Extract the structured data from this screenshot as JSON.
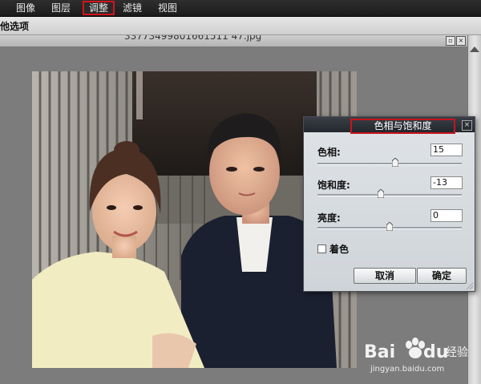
{
  "menubar": {
    "items": [
      "图像",
      "图层",
      "调整",
      "滤镜",
      "视图"
    ],
    "active_index": 2
  },
  "options_bar": {
    "label": "他选项"
  },
  "document": {
    "title": "33773499801661511 47.jpg"
  },
  "dialog": {
    "title": "色相与饱和度",
    "hue": {
      "label": "色相:",
      "value": "15"
    },
    "saturation": {
      "label": "饱和度:",
      "value": "-13"
    },
    "brightness": {
      "label": "亮度:",
      "value": "0"
    },
    "colorize": {
      "label": "着色",
      "checked": false
    },
    "cancel_label": "取消",
    "ok_label": "确定"
  },
  "watermark": {
    "brand": "Bai du 经验",
    "url": "jingyan.baidu.com"
  },
  "colors": {
    "highlight": "#c8141c",
    "menubar": "#222222",
    "dialog_title": "#2a2e34"
  }
}
